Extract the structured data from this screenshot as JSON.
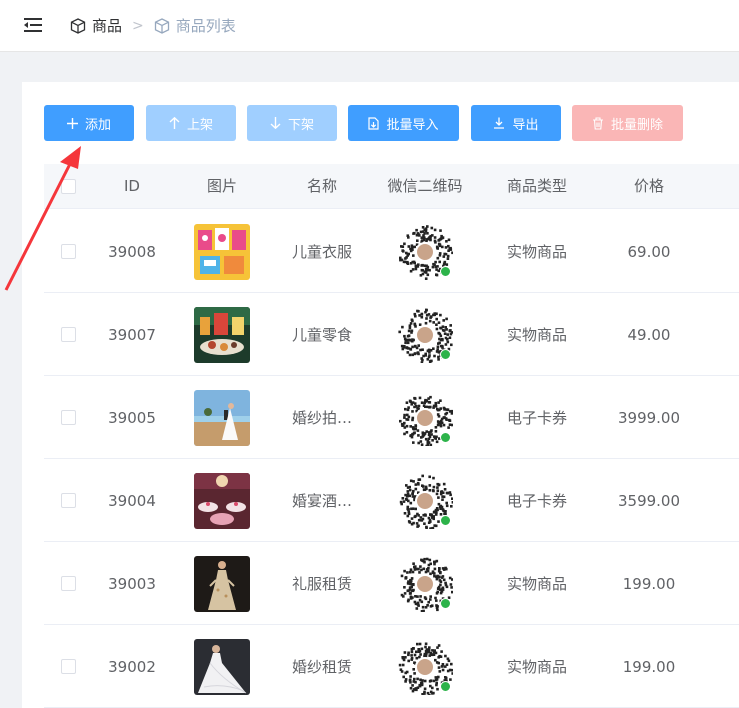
{
  "breadcrumb": {
    "root": "商品",
    "separator": ">",
    "current": "商品列表"
  },
  "toolbar": {
    "add": "添加",
    "shelf_up": "上架",
    "shelf_down": "下架",
    "batch_import": "批量导入",
    "export": "导出",
    "batch_delete": "批量删除"
  },
  "table": {
    "headers": {
      "id": "ID",
      "image": "图片",
      "name": "名称",
      "qrcode": "微信二维码",
      "type": "商品类型",
      "price": "价格"
    },
    "rows": [
      {
        "id": "39008",
        "name": "儿童衣服",
        "type": "实物商品",
        "price": "69.00",
        "image": "kids-clothes"
      },
      {
        "id": "39007",
        "name": "儿童零食",
        "type": "实物商品",
        "price": "49.00",
        "image": "kids-snacks"
      },
      {
        "id": "39005",
        "name": "婚纱拍…",
        "type": "电子卡券",
        "price": "3999.00",
        "image": "wedding-photo"
      },
      {
        "id": "39004",
        "name": "婚宴酒…",
        "type": "电子卡券",
        "price": "3599.00",
        "image": "wedding-banquet"
      },
      {
        "id": "39003",
        "name": "礼服租赁",
        "type": "实物商品",
        "price": "199.00",
        "image": "gown"
      },
      {
        "id": "39002",
        "name": "婚纱租赁",
        "type": "实物商品",
        "price": "199.00",
        "image": "wedding-dress"
      }
    ]
  },
  "colors": {
    "primary": "#409eff",
    "primary_disabled": "#a0cfff",
    "danger_disabled": "#fab6b6",
    "annotation_arrow": "#f5363b"
  }
}
